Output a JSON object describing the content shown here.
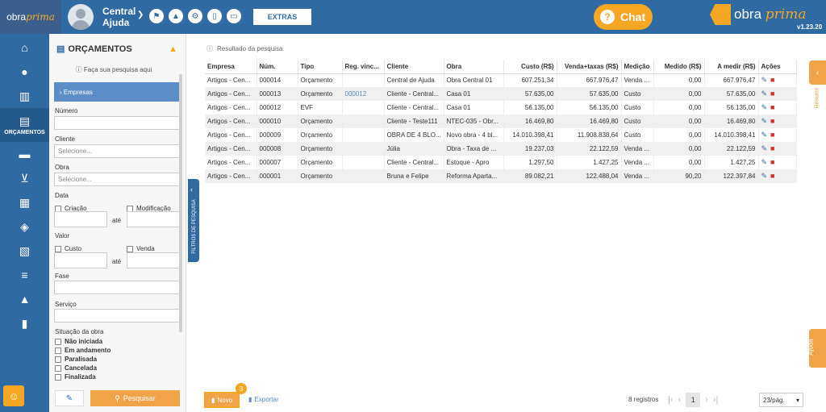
{
  "header": {
    "logo_prefix": "obra",
    "logo_suffix": "prima",
    "company_line1": "Central",
    "company_line2": "Ajuda",
    "extras_label": "EXTRAS",
    "chat_label": "Chat",
    "brand_prefix": "obra",
    "brand_suffix": "prima",
    "version": "v1.23.20",
    "icons": [
      "flag-icon",
      "graduation-cap-icon",
      "gear-icon",
      "mobile-icon",
      "monitor-icon"
    ]
  },
  "nav": {
    "active_label": "ORÇAMENTOS"
  },
  "filters": {
    "title": "ORÇAMENTOS",
    "hint": "Faça sua pesquisa aqui",
    "empresas": "Empresas",
    "numero": "Número",
    "cliente": "Cliente",
    "cliente_placeholder": "Selecione...",
    "obra": "Obra",
    "obra_placeholder": "Selecione...",
    "data": "Data",
    "criacao": "Criação",
    "modificacao": "Modificação",
    "ate": "até",
    "valor": "Valor",
    "custo": "Custo",
    "venda": "Venda",
    "fase": "Fase",
    "servico": "Serviço",
    "situacao": "Situação da obra",
    "situacoes": [
      "Não iniciada",
      "Em andamento",
      "Paralisada",
      "Cancelada",
      "Finalizada"
    ],
    "search_label": "Pesquisar",
    "collapse_label": "FILTROS DE PESQUISA"
  },
  "results": {
    "label": "Resultado da pesquisa",
    "columns": [
      "Empresa",
      "Núm.",
      "Tipo",
      "Reg. vinc...",
      "Cliente",
      "Obra",
      "Custo (R$)",
      "Venda+taxas (R$)",
      "Medição",
      "Medido (R$)",
      "A medir (R$)",
      "Ações"
    ],
    "rows": [
      [
        "Artigos - Cen...",
        "000014",
        "Orçamento",
        "",
        "Central de Ajuda",
        "Obra Central 01",
        "607.251,34",
        "667.976,47",
        "Venda ...",
        "0,00",
        "667.976,47"
      ],
      [
        "Artigos - Cen...",
        "000013",
        "Orçamento",
        "000012",
        "Cliente - Central...",
        "Casa 01",
        "57.635,00",
        "57.635,00",
        "Custo",
        "0,00",
        "57.635,00"
      ],
      [
        "Artigos - Cen...",
        "000012",
        "EVF",
        "",
        "Cliente - Central...",
        "Casa 01",
        "56.135,00",
        "56.135,00",
        "Custo",
        "0,00",
        "56.135,00"
      ],
      [
        "Artigos - Cen...",
        "000010",
        "Orçamento",
        "",
        "Cliente - Teste111",
        "NTEC-035 - Obr...",
        "16.469,80",
        "16.469,80",
        "Custo",
        "0,00",
        "16.469,80"
      ],
      [
        "Artigos - Cen...",
        "000009",
        "Orçamento",
        "",
        "OBRA DE 4 BLO...",
        "Novo obra - 4 bl...",
        "14.010.398,41",
        "11.908.838,64",
        "Custo",
        "0,00",
        "14.010.398,41"
      ],
      [
        "Artigos - Cen...",
        "000008",
        "Orçamento",
        "",
        "Júlia",
        "Obra - Taxa de ...",
        "19.237,03",
        "22.122,59",
        "Venda ...",
        "0,00",
        "22.122,59"
      ],
      [
        "Artigos - Cen...",
        "000007",
        "Orçamento",
        "",
        "Cliente - Central...",
        "Estoque - Apro",
        "1.297,50",
        "1.427,25",
        "Venda ...",
        "0,00",
        "1.427,25"
      ],
      [
        "Artigos - Cen...",
        "000001",
        "Orçamento",
        "",
        "Bruna e Felipe",
        "Reforma Aparta...",
        "89.082,21",
        "122.488,04",
        "Venda ...",
        "90,20",
        "122.397,84"
      ]
    ]
  },
  "footer": {
    "novo_label": "Novo",
    "badge": "3",
    "exportar_label": "Exportar",
    "count": "8 registros",
    "current_page": "1",
    "page_size": "23/pág."
  },
  "side": {
    "resumo": "Resumo",
    "ajuda": "Ajuda"
  }
}
